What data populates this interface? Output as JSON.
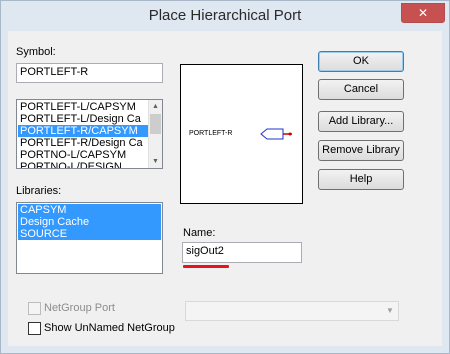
{
  "window": {
    "title": "Place Hierarchical Port",
    "close_glyph": "✕"
  },
  "symbol": {
    "label": "Symbol:",
    "value": "PORTLEFT-R",
    "list": [
      {
        "label": "PORTLEFT-L/CAPSYM",
        "selected": false
      },
      {
        "label": "PORTLEFT-L/Design Ca",
        "selected": false
      },
      {
        "label": "PORTLEFT-R/CAPSYM",
        "selected": true
      },
      {
        "label": "PORTLEFT-R/Design Ca",
        "selected": false
      },
      {
        "label": "PORTNO-L/CAPSYM",
        "selected": false
      },
      {
        "label": "PORTNO-L/DESIGN",
        "selected": false
      }
    ]
  },
  "libraries": {
    "label": "Libraries:",
    "list": [
      {
        "label": "CAPSYM",
        "selected": true
      },
      {
        "label": "Design Cache",
        "selected": true
      },
      {
        "label": "SOURCE",
        "selected": true
      }
    ]
  },
  "preview": {
    "port_label": "PORTLEFT-R",
    "port_color": "#2233cc",
    "pin_color": "#cc0000"
  },
  "name": {
    "label": "Name:",
    "value": "sigOut2",
    "highlight_color": "#e8141c"
  },
  "buttons": {
    "ok": "OK",
    "cancel": "Cancel",
    "add_library": "Add Library...",
    "remove_library": "Remove Library",
    "help": "Help"
  },
  "netgroup": {
    "netgroup_port_label": "NetGroup Port",
    "netgroup_port_checked": false,
    "netgroup_port_enabled": false,
    "show_unnamed_label": "Show UnNamed NetGroup",
    "show_unnamed_checked": false,
    "combo_value": ""
  }
}
